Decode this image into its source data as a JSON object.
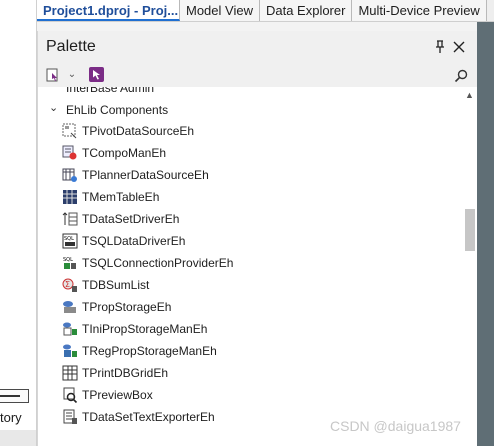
{
  "tabs": [
    {
      "label": "Project1.dproj - Proj...",
      "active": true
    },
    {
      "label": "Model View",
      "active": false
    },
    {
      "label": "Data Explorer",
      "active": false
    },
    {
      "label": "Multi-Device Preview",
      "active": false
    }
  ],
  "left_panel": {
    "label_fragment": "tory"
  },
  "palette": {
    "title": "Palette",
    "pin_icon": "pin-icon",
    "close_icon": "close-icon",
    "search": {
      "value": "",
      "placeholder": ""
    },
    "partial_category": "InterBase Admin",
    "category": {
      "label": "EhLib Components",
      "expanded": true
    },
    "items": [
      {
        "label": "TPivotDataSourceEh",
        "icon": "pivot-icon"
      },
      {
        "label": "TCompoManEh",
        "icon": "compoman-icon"
      },
      {
        "label": "TPlannerDataSourceEh",
        "icon": "planner-icon"
      },
      {
        "label": "TMemTableEh",
        "icon": "memtable-icon"
      },
      {
        "label": "TDataSetDriverEh",
        "icon": "datasetdriver-icon"
      },
      {
        "label": "TSQLDataDriverEh",
        "icon": "sqldatadriver-icon"
      },
      {
        "label": "TSQLConnectionProviderEh",
        "icon": "sqlconnection-icon"
      },
      {
        "label": "TDBSumList",
        "icon": "sumlist-icon"
      },
      {
        "label": "TPropStorageEh",
        "icon": "propstorage-icon"
      },
      {
        "label": "TIniPropStorageManEh",
        "icon": "inipropstorage-icon"
      },
      {
        "label": "TRegPropStorageManEh",
        "icon": "regpropstorage-icon"
      },
      {
        "label": "TPrintDBGridEh",
        "icon": "printgrid-icon"
      },
      {
        "label": "TPreviewBox",
        "icon": "previewbox-icon"
      },
      {
        "label": "TDataSetTextExporterEh",
        "icon": "textexporter-icon"
      }
    ]
  },
  "watermark": "CSDN @daigua1987",
  "colors": {
    "active_tab": "#1f4e9a",
    "accent": "#1f6fd1",
    "right_strip": "#5f6e75"
  }
}
